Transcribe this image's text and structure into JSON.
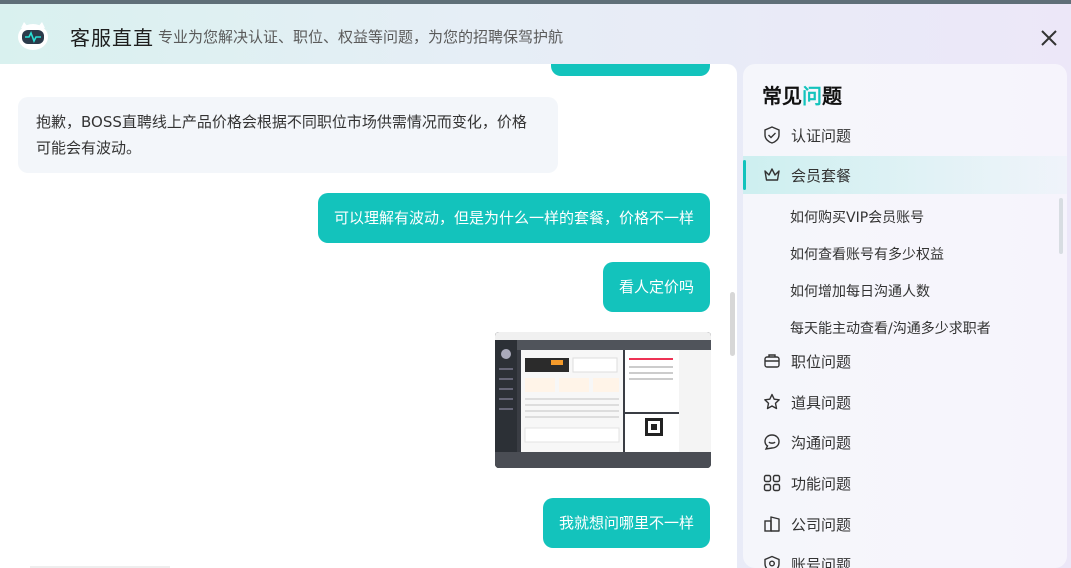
{
  "header": {
    "title": "客服直直",
    "subtitle": "专业为您解决认证、职位、权益等问题，为您的招聘保驾护航"
  },
  "chat": {
    "messages": [
      {
        "role": "service",
        "text": "抱歉，BOSS直聘线上产品价格会根据不同职位市场供需情况而变化，价格可能会有波动。"
      },
      {
        "role": "user",
        "text": "可以理解有波动，但是为什么一样的套餐，价格不一样"
      },
      {
        "role": "user",
        "text": "看人定价吗"
      },
      {
        "role": "user",
        "type": "image"
      },
      {
        "role": "user",
        "text": "我就想问哪里不一样"
      }
    ]
  },
  "sidebar": {
    "title_a": "常见",
    "title_b": "问",
    "title_c": "题",
    "items": [
      {
        "label": "认证问题",
        "icon": "shield-check-icon"
      },
      {
        "label": "会员套餐",
        "icon": "crown-icon",
        "active": true,
        "subitems": [
          "如何购买VIP会员账号",
          "如何查看账号有多少权益",
          "如何增加每日沟通人数",
          "每天能主动查看/沟通多少求职者"
        ]
      },
      {
        "label": "职位问题",
        "icon": "briefcase-icon"
      },
      {
        "label": "道具问题",
        "icon": "star-icon"
      },
      {
        "label": "沟通问题",
        "icon": "chat-bubble-icon"
      },
      {
        "label": "功能问题",
        "icon": "grid-icon"
      },
      {
        "label": "公司问题",
        "icon": "building-icon"
      },
      {
        "label": "账号问题",
        "icon": "account-icon"
      }
    ]
  },
  "colors": {
    "accent": "#13c3bc",
    "header_bg": "#dceff0"
  }
}
